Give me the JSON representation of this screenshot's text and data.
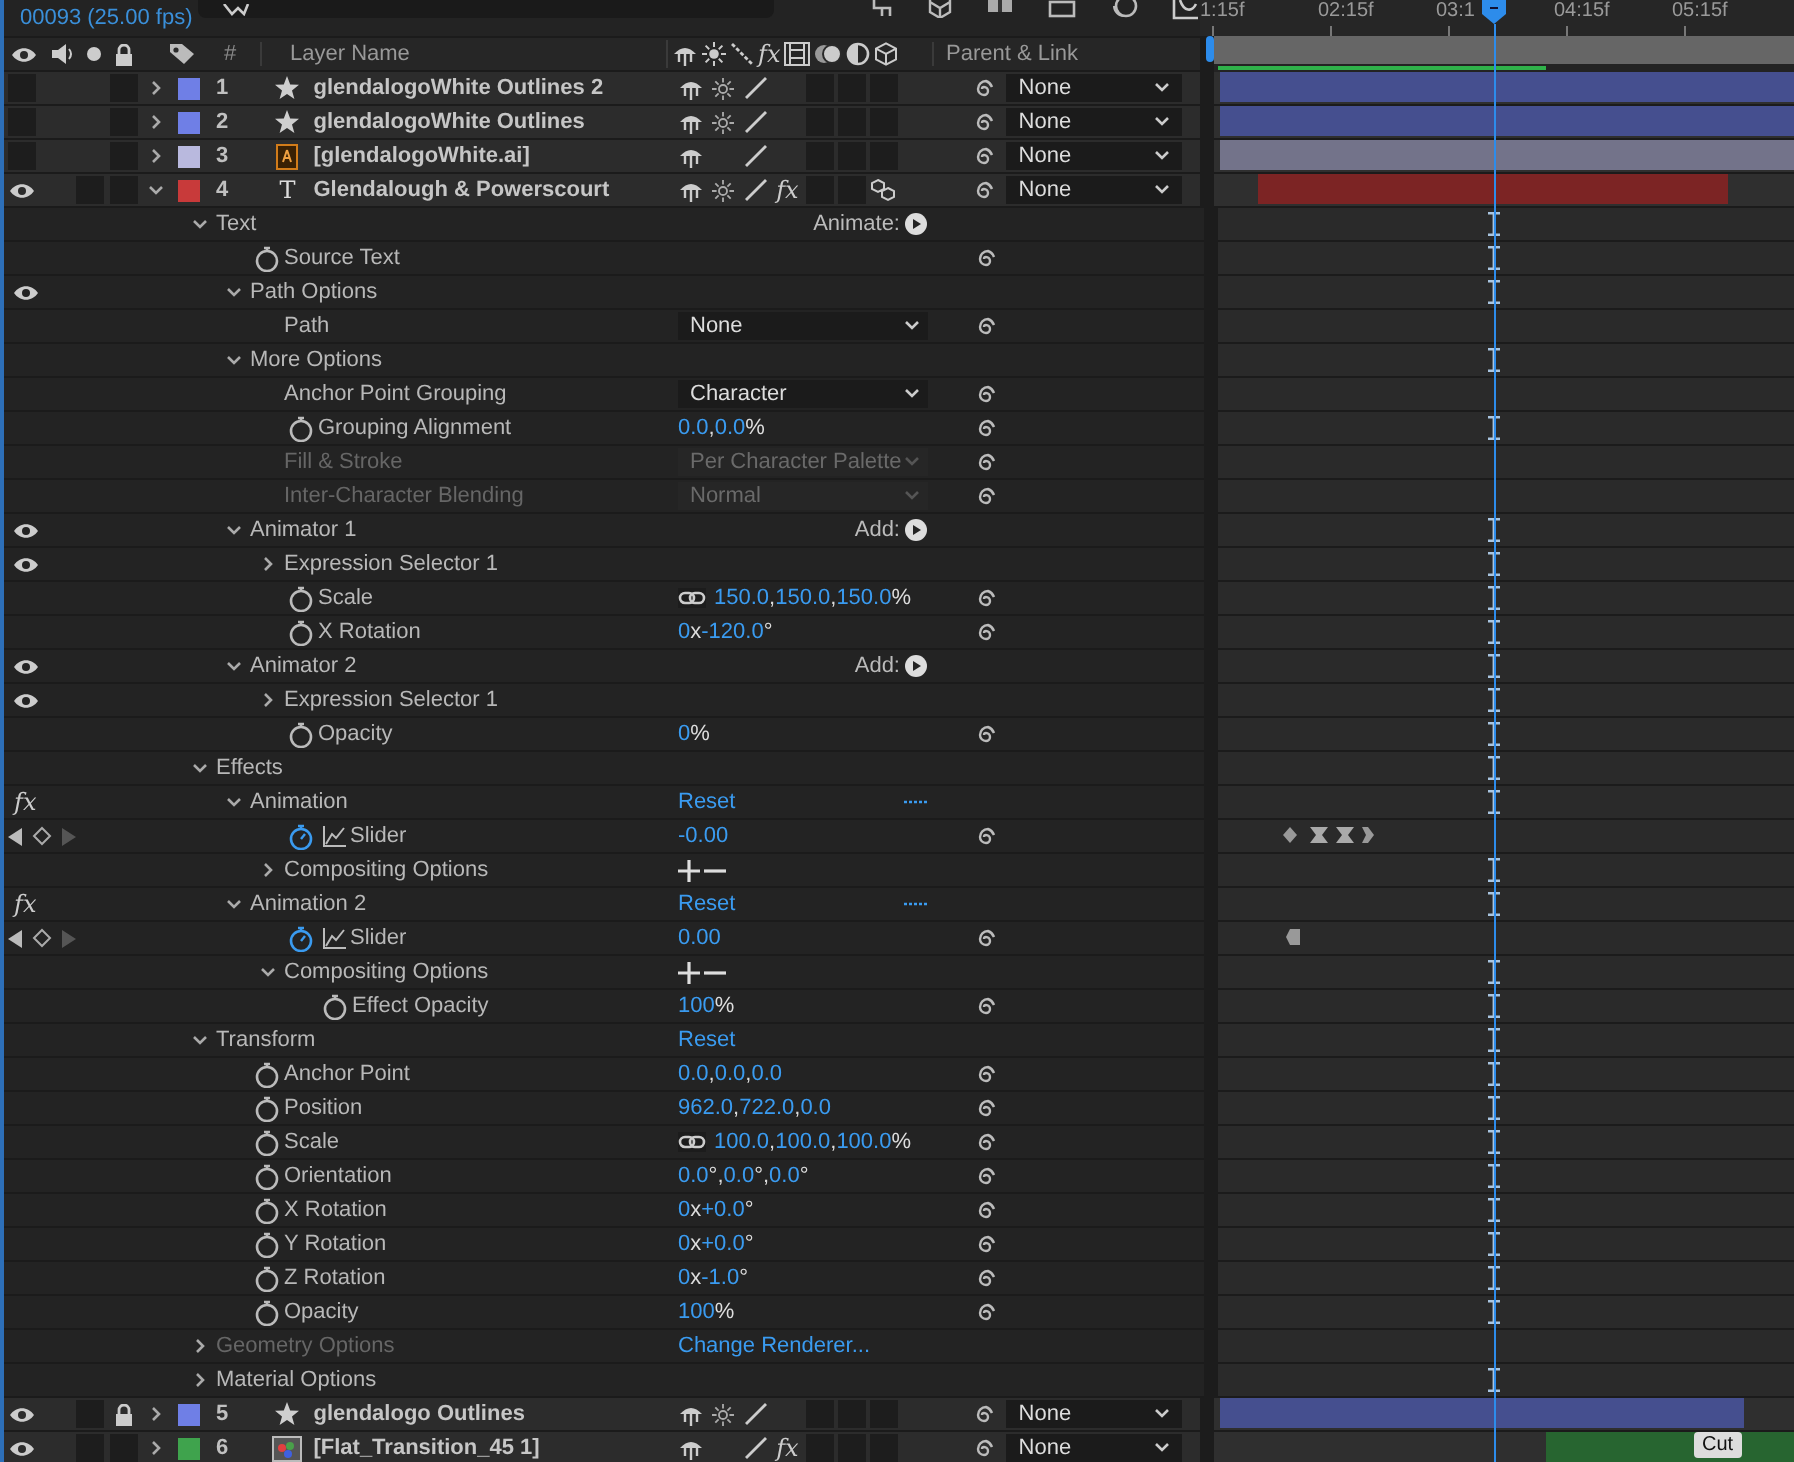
{
  "header": {
    "timecode": "00093 (25.00 fps)",
    "number": "#",
    "layer_name": "Layer Name",
    "fx": "fx",
    "parent": "Parent & Link"
  },
  "ruler": [
    "1:15f",
    "02:15f",
    "03:1",
    "04:15f",
    "05:15f"
  ],
  "layers": [
    {
      "number": "1",
      "kind": "shape",
      "name": "glendalogoWhite Outlines 2",
      "color": "#6f7fe6",
      "visible": false,
      "locked": false,
      "expanded": false,
      "switches": [
        {
          "kind": "shy"
        },
        {
          "kind": "collapse"
        },
        {
          "kind": "quality"
        }
      ],
      "parent": "None"
    },
    {
      "number": "2",
      "kind": "shape",
      "name": "glendalogoWhite Outlines",
      "color": "#6f7fe6",
      "visible": false,
      "locked": false,
      "expanded": false,
      "switches": [
        {
          "kind": "shy"
        },
        {
          "kind": "collapse"
        },
        {
          "kind": "quality"
        }
      ],
      "parent": "None"
    },
    {
      "number": "3",
      "kind": "ai",
      "name": "[glendalogoWhite.ai]",
      "color": "#b9b9de",
      "visible": false,
      "locked": false,
      "expanded": false,
      "switches": [
        {
          "kind": "shy"
        },
        {
          "kind": "quality"
        }
      ],
      "parent": "None"
    },
    {
      "number": "4",
      "kind": "text",
      "glyph": "T",
      "name": "Glendalough & Powerscourt",
      "color": "#c83a3a",
      "visible": true,
      "locked": false,
      "expanded": true,
      "switches": [
        {
          "kind": "shy"
        },
        {
          "kind": "collapse"
        },
        {
          "kind": "quality"
        },
        {
          "kind": "threed"
        }
      ],
      "effects": {
        "label": "fx",
        "on": true
      },
      "parent": "None",
      "properties": [
        {
          "name": "Text",
          "kind": "group",
          "expanded": true,
          "disabled": false,
          "action": "Animate:",
          "children": [
            {
              "name": "Source Text",
              "kind": "plain",
              "disabled": false,
              "stopwatch": true
            },
            {
              "name": "Path Options",
              "kind": "group",
              "expanded": true,
              "disabled": false,
              "eye": true,
              "children": [
                {
                  "name": "Path",
                  "kind": "dropdown",
                  "disabled": false,
                  "value": "None"
                }
              ]
            },
            {
              "name": "More Options",
              "kind": "group",
              "expanded": true,
              "disabled": false,
              "children": [
                {
                  "name": "Anchor Point Grouping",
                  "kind": "dropdown",
                  "disabled": false,
                  "value": "Character"
                },
                {
                  "name": "Grouping Alignment",
                  "kind": "number",
                  "disabled": false,
                  "stopwatch": true,
                  "value": "0.0,0.0%"
                },
                {
                  "name": "Fill & Stroke",
                  "kind": "dropdown",
                  "disabled": true,
                  "value": "Per Character Palette"
                },
                {
                  "name": "Inter-Character Blending",
                  "kind": "dropdown",
                  "disabled": true,
                  "value": "Normal"
                }
              ]
            },
            {
              "name": "Animator 1",
              "kind": "group",
              "expanded": true,
              "disabled": false,
              "eye": true,
              "action": "Add:",
              "children": [
                {
                  "name": "Expression Selector 1",
                  "kind": "group",
                  "expanded": false,
                  "disabled": false,
                  "eye": true
                },
                {
                  "name": "Scale",
                  "kind": "number",
                  "disabled": false,
                  "stopwatch": true,
                  "link": true,
                  "value": "150.0,150.0,150.0%"
                },
                {
                  "name": "X Rotation",
                  "kind": "number",
                  "disabled": false,
                  "stopwatch": true,
                  "value": "0x-120.0°"
                }
              ]
            },
            {
              "name": "Animator 2",
              "kind": "group",
              "expanded": true,
              "disabled": false,
              "eye": true,
              "action": "Add:",
              "children": [
                {
                  "name": "Expression Selector 1",
                  "kind": "group",
                  "expanded": false,
                  "disabled": false,
                  "eye": true
                },
                {
                  "name": "Opacity",
                  "kind": "number",
                  "disabled": false,
                  "stopwatch": true,
                  "value": "0%"
                }
              ]
            }
          ]
        },
        {
          "name": "Effects",
          "kind": "group",
          "expanded": true,
          "disabled": false,
          "children": [
            {
              "name": "Animation",
              "kind": "link",
              "expanded": true,
              "disabled": false,
              "effect": {
                "label": "fx",
                "on": true
              },
              "value": "Reset",
              "options": true,
              "children": [
                {
                  "name": "Slider",
                  "kind": "number",
                  "disabled": false,
                  "stopwatch": true,
                  "animated": true,
                  "keyframe_nav": true,
                  "value": "-0.00",
                  "keyframes": [
                    {
                      "kind": "diamond"
                    },
                    {
                      "kind": "hourglass"
                    },
                    {
                      "kind": "hourglass"
                    },
                    {
                      "kind": "end"
                    }
                  ]
                },
                {
                  "name": "Compositing Options",
                  "kind": "plusminus",
                  "expanded": false,
                  "disabled": false
                }
              ]
            },
            {
              "name": "Animation 2",
              "kind": "link",
              "expanded": true,
              "disabled": false,
              "effect": {
                "label": "fx",
                "on": true
              },
              "value": "Reset",
              "options": true,
              "children": [
                {
                  "name": "Slider",
                  "kind": "number",
                  "disabled": false,
                  "stopwatch": true,
                  "animated": true,
                  "keyframe_nav": true,
                  "value": "0.00",
                  "keyframes": [
                    {
                      "kind": "start"
                    }
                  ]
                },
                {
                  "name": "Compositing Options",
                  "kind": "plusminus",
                  "expanded": true,
                  "disabled": false,
                  "children": [
                    {
                      "name": "Effect Opacity",
                      "kind": "number",
                      "disabled": false,
                      "stopwatch": true,
                      "value": "100%"
                    }
                  ]
                }
              ]
            }
          ]
        },
        {
          "name": "Transform",
          "kind": "link",
          "expanded": true,
          "disabled": false,
          "value": "Reset",
          "children": [
            {
              "name": "Anchor Point",
              "kind": "number",
              "disabled": false,
              "stopwatch": true,
              "value": "0.0,0.0,0.0"
            },
            {
              "name": "Position",
              "kind": "number",
              "disabled": false,
              "stopwatch": true,
              "value": "962.0,722.0,0.0"
            },
            {
              "name": "Scale",
              "kind": "number",
              "disabled": false,
              "stopwatch": true,
              "link": true,
              "value": "100.0,100.0,100.0%"
            },
            {
              "name": "Orientation",
              "kind": "number",
              "disabled": false,
              "stopwatch": true,
              "value": "0.0°,0.0°,0.0°"
            },
            {
              "name": "X Rotation",
              "kind": "number",
              "disabled": false,
              "stopwatch": true,
              "value": "0x+0.0°"
            },
            {
              "name": "Y Rotation",
              "kind": "number",
              "disabled": false,
              "stopwatch": true,
              "value": "0x+0.0°"
            },
            {
              "name": "Z Rotation",
              "kind": "number",
              "disabled": false,
              "stopwatch": true,
              "value": "0x-1.0°"
            },
            {
              "name": "Opacity",
              "kind": "number",
              "disabled": false,
              "stopwatch": true,
              "value": "100%"
            }
          ]
        },
        {
          "name": "Geometry Options",
          "kind": "link",
          "expanded": false,
          "disabled": true,
          "value": "Change Renderer..."
        },
        {
          "name": "Material Options",
          "kind": "group",
          "expanded": false,
          "disabled": false
        }
      ]
    },
    {
      "number": "5",
      "kind": "shape",
      "name": "glendalogo Outlines",
      "color": "#6f7fe6",
      "visible": true,
      "locked": true,
      "expanded": false,
      "switches": [
        {
          "kind": "shy"
        },
        {
          "kind": "collapse"
        },
        {
          "kind": "quality"
        }
      ],
      "parent": "None"
    },
    {
      "number": "6",
      "kind": "footage",
      "name": "[Flat_Transition_45 1]",
      "color": "#3fa34d",
      "visible": true,
      "locked": false,
      "expanded": false,
      "switches": [
        {
          "kind": "shy"
        },
        {
          "kind": "quality"
        }
      ],
      "effects": {
        "label": "fx",
        "on": true
      },
      "parent": "None",
      "marker": "Cut"
    }
  ]
}
